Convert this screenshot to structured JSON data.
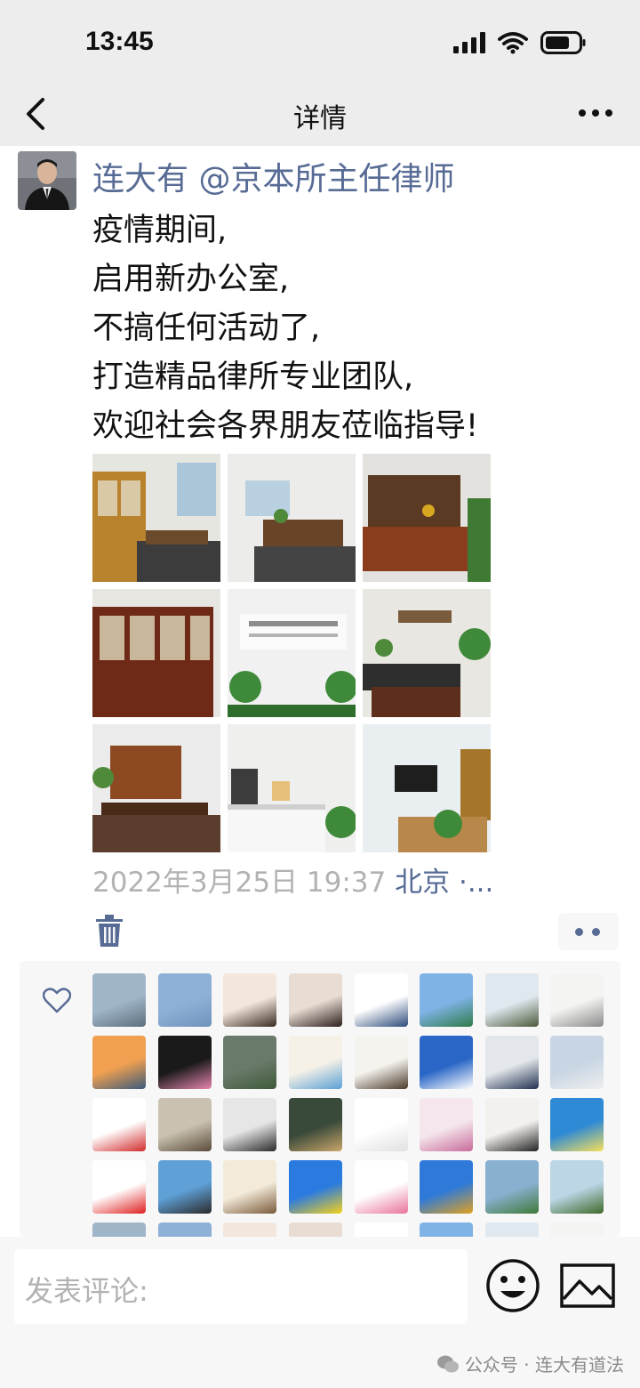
{
  "status_bar": {
    "time": "13:45"
  },
  "nav": {
    "title": "详情"
  },
  "post": {
    "author": "连大有 @京本所主任律师",
    "lines": [
      "疫情期间,",
      "启用新办公室,",
      "不搞任何活动了,",
      "打造精品律所专业团队,",
      "欢迎社会各界朋友莅临指导!"
    ],
    "timestamp": "2022年3月25日 19:37",
    "location": "北京 ·..."
  },
  "comment": {
    "placeholder": "发表评论:"
  },
  "watermark": {
    "text": "公众号 · 连大有道法"
  },
  "icons": [
    "back-icon",
    "more-icon",
    "trash-icon",
    "heart-icon",
    "emoji-icon",
    "image-icon",
    "wechat-icon"
  ],
  "colors": {
    "link": "#576b95",
    "meta": "#b2b2b2",
    "bar": "#ededed",
    "panel": "#f7f7f7"
  }
}
